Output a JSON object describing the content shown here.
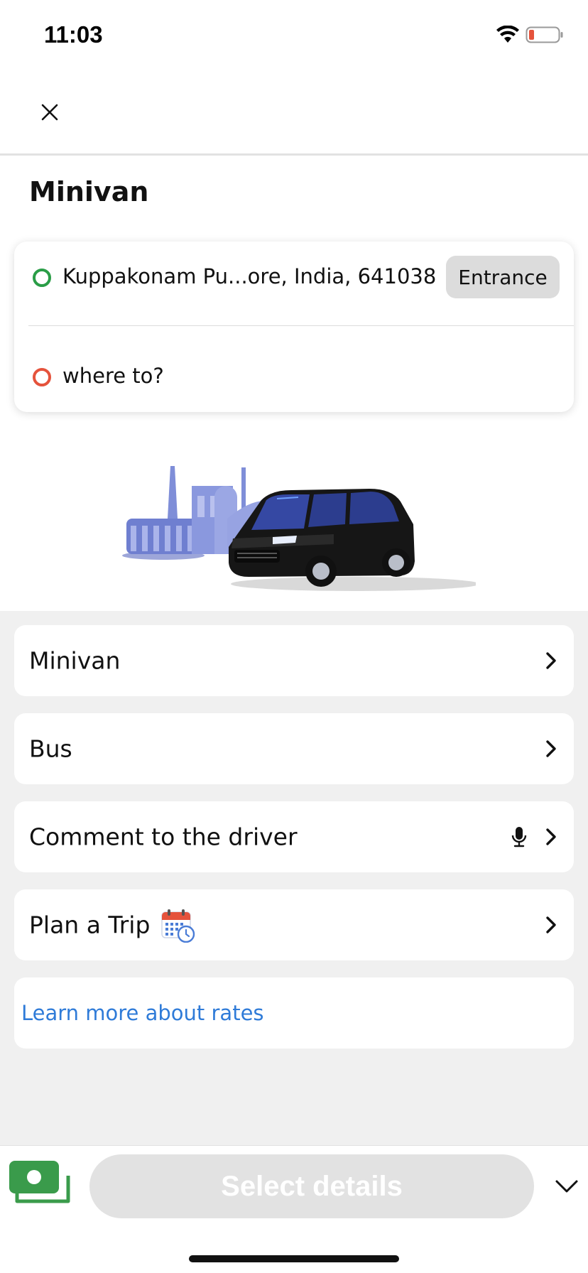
{
  "status_bar": {
    "time": "11:03"
  },
  "page": {
    "title": "Minivan"
  },
  "route": {
    "origin": "Kuppakonam Pu...ore, India, 641038",
    "entrance_label": "Entrance",
    "destination_placeholder": "where to?"
  },
  "options": {
    "minivan": "Minivan",
    "bus": "Bus",
    "comment": "Comment to the driver",
    "plan_trip": "Plan a Trip",
    "rates_link": "Learn more about rates"
  },
  "bottom": {
    "select_label": "Select details"
  },
  "colors": {
    "origin_dot": "#2a9d47",
    "destination_dot": "#e5533c",
    "link": "#2f7bd8",
    "cash_icon": "#3a9b4b",
    "battery_low": "#e5533c"
  },
  "icons": [
    "close-icon",
    "wifi-icon",
    "battery-icon",
    "chevron-right-icon",
    "mic-icon",
    "calendar-icon",
    "cash-icon",
    "chevron-down-icon"
  ]
}
